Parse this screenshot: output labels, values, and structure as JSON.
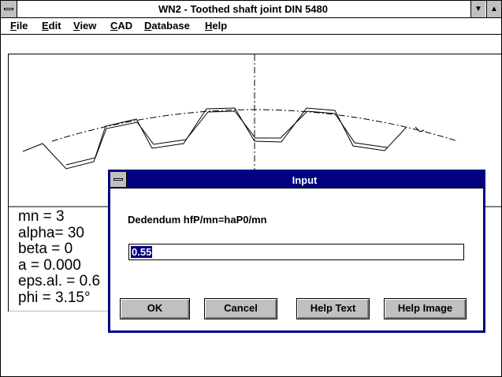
{
  "window": {
    "title": "WN2 - Toothed shaft joint DIN 5480",
    "minimize_glyph": "▼",
    "maximize_glyph": "▲"
  },
  "menu": [
    "File",
    "Edit",
    "View",
    "CAD",
    "Database",
    "Help"
  ],
  "readout": {
    "lines": [
      "mn = 3",
      "alpha= 30",
      "beta = 0",
      "a = 0.000",
      "eps.al. = 0.6",
      "phi = 3.15°"
    ]
  },
  "dialog": {
    "title": "Input",
    "prompt": "Dedendum hfP/mn=haP0/mn",
    "value": "0.55",
    "buttons": {
      "ok": "OK",
      "cancel": "Cancel",
      "help_text": "Help Text",
      "help_image": "Help Image"
    }
  },
  "colors": {
    "dialog_frame": "#000080",
    "button_face": "#c0c0c0",
    "selection": "#000080"
  }
}
